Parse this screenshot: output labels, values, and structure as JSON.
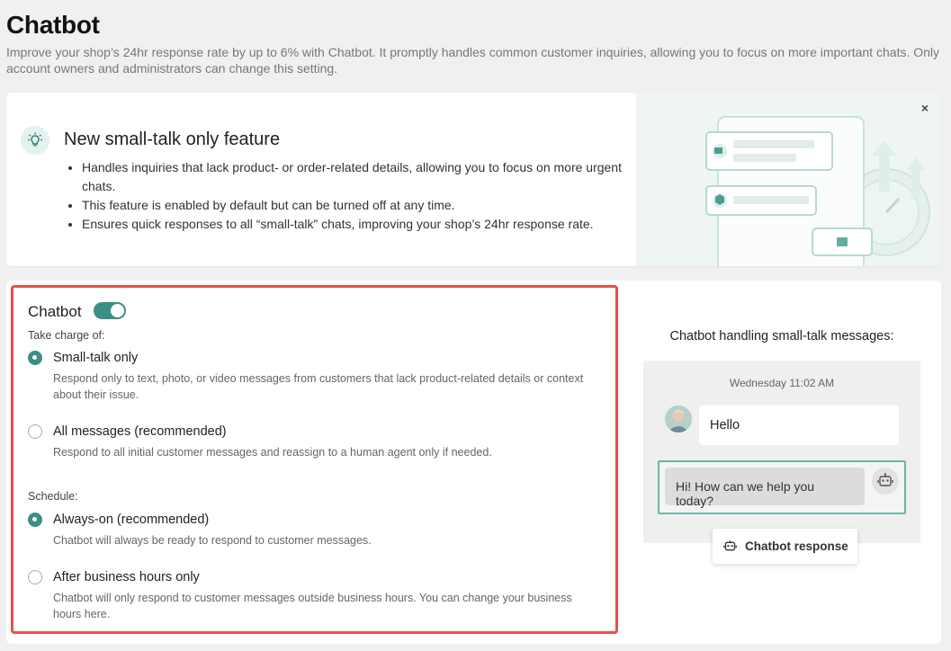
{
  "header": {
    "title": "Chatbot",
    "description": "Improve your shop’s 24hr response rate by up to 6% with Chatbot. It promptly handles common customer inquiries, allowing you to focus on more important chats. Only account owners and administrators can change this setting."
  },
  "banner": {
    "icon": "lightbulb-icon",
    "title": "New small-talk only feature",
    "bullets": [
      "Handles inquiries that lack product- or order-related details, allowing you to focus on more urgent chats.",
      "This feature is enabled by default but can be turned off at any time.",
      "Ensures quick responses to all “small-talk” chats, improving your shop’s 24hr response rate."
    ],
    "close_label": "×"
  },
  "settings": {
    "chatbot_label": "Chatbot",
    "chatbot_enabled": true,
    "take_charge_label": "Take charge of:",
    "take_charge_options": [
      {
        "label": "Small-talk only",
        "description": "Respond only to text, photo, or video messages from customers that lack product-related details or context about their issue.",
        "selected": true
      },
      {
        "label": "All messages (recommended)",
        "description": "Respond to all initial customer messages and reassign to a human agent only if needed.",
        "selected": false
      }
    ],
    "schedule_label": "Schedule:",
    "schedule_options": [
      {
        "label": "Always-on (recommended)",
        "description": "Chatbot will always be ready to respond to customer messages.",
        "selected": true
      },
      {
        "label": "After business hours only",
        "description": "Chatbot will only respond to customer messages outside business hours. You can change your business hours here.",
        "selected": false
      }
    ]
  },
  "preview": {
    "title": "Chatbot handling small-talk messages:",
    "timestamp": "Wednesday  11:02 AM",
    "customer_message": "Hello",
    "bot_message": "Hi! How can we help you today?",
    "chip_label": "Chatbot response",
    "chip_icon": "robot-icon"
  },
  "colors": {
    "accent": "#3a8f87",
    "highlight_border": "#e8504a"
  }
}
